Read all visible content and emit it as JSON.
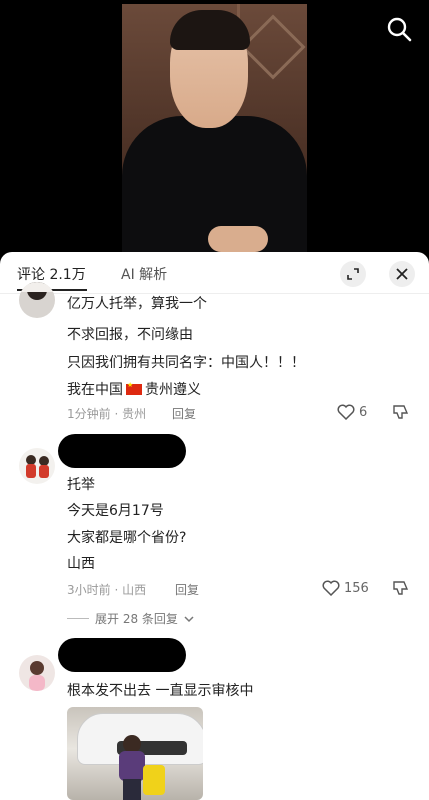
{
  "header": {
    "tab_comments": "评论 2.1万",
    "tab_ai": "AI 解析"
  },
  "comments": [
    {
      "lines": [
        "亿万人托举，算我一个",
        "不求回报，不问缘由",
        "只因我们拥有共同名字：中国人！！！"
      ],
      "location_prefix": "我在中国",
      "location_suffix": "贵州遵义",
      "time": "1分钟前 · 贵州",
      "reply_label": "回复",
      "likes": "6"
    },
    {
      "lines": [
        "托举",
        "今天是6月17号",
        "大家都是哪个省份?",
        "山西"
      ],
      "time": "3小时前 · 山西",
      "reply_label": "回复",
      "likes": "156",
      "expand_replies": "展开 28 条回复"
    },
    {
      "lines": [
        "根本发不出去 一直显示审核中"
      ]
    }
  ],
  "colors": {
    "panel_bg": "#ffffff",
    "text": "#222222",
    "meta": "#9a9a9a",
    "flag_red": "#de2910"
  }
}
